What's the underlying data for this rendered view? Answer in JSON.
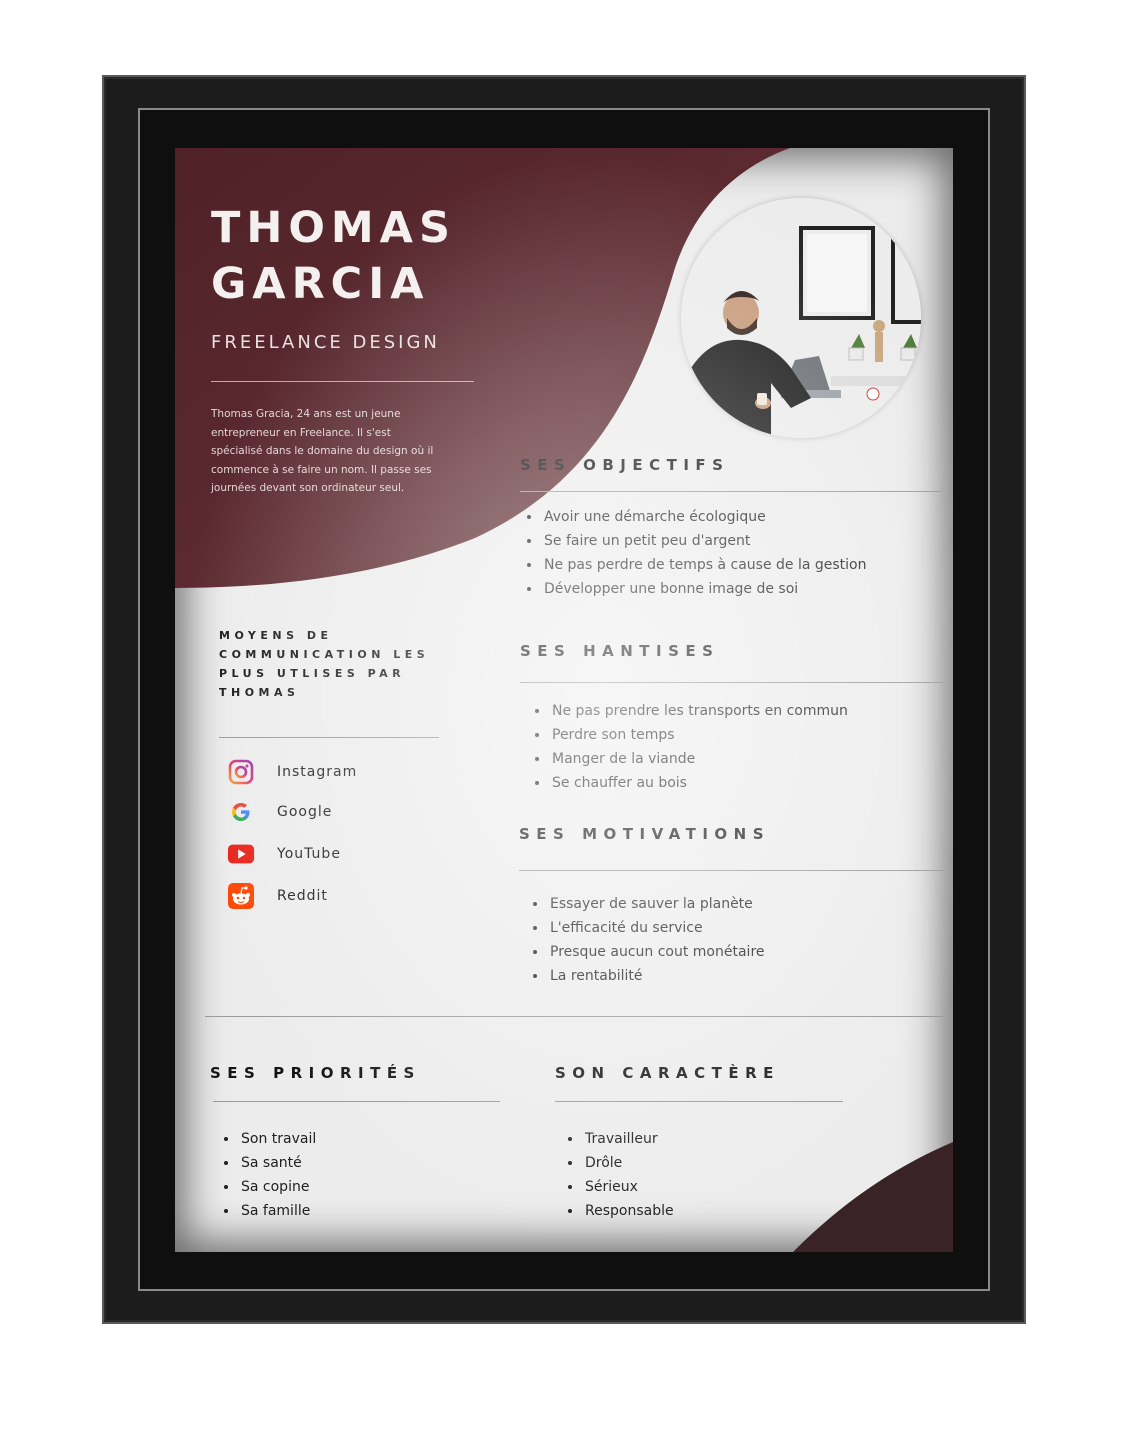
{
  "profile": {
    "name_line1": "THOMAS",
    "name_line2": "GARCIA",
    "role": "FREELANCE DESIGN",
    "bio": "Thomas Gracia, 24 ans est un jeune entrepreneur en Freelance. Il s'est spécialisé dans le domaine du design où il commence à se faire un nom. Il passe ses journées devant son ordinateur seul."
  },
  "communication": {
    "title": "MOYENS DE COMMUNICATION LES PLUS UTLISES PAR THOMAS",
    "items": [
      {
        "label": "Instagram",
        "icon": "instagram-icon"
      },
      {
        "label": "Google",
        "icon": "google-icon"
      },
      {
        "label": "YouTube",
        "icon": "youtube-icon"
      },
      {
        "label": "Reddit",
        "icon": "reddit-icon"
      }
    ]
  },
  "objectifs": {
    "title": "SES OBJECTIFS",
    "items": [
      "Avoir une démarche écologique",
      "Se faire un petit peu d'argent",
      "Ne pas perdre de temps à cause de la gestion",
      "Développer une bonne image de soi"
    ]
  },
  "hantises": {
    "title": "SES HANTISES",
    "items": [
      "Ne pas prendre les transports en commun",
      "Perdre son temps",
      "Manger de la viande",
      "Se chauffer au bois"
    ]
  },
  "motivations": {
    "title": "SES MOTIVATIONS",
    "items": [
      "Essayer de sauver la planète",
      "L'efficacité du service",
      "Presque aucun cout monétaire",
      "La rentabilité"
    ]
  },
  "priorites": {
    "title": "SES PRIORITÉS",
    "items": [
      "Son travail",
      "Sa santé",
      "Sa copine",
      "Sa famille"
    ]
  },
  "caractere": {
    "title": "SON CARACTÈRE",
    "items": [
      "Travailleur",
      "Drôle",
      "Sérieux",
      "Responsable"
    ]
  },
  "colors": {
    "accent": "#5b2a2f",
    "frame": "#1c1c1c",
    "paper": "#ececec"
  }
}
